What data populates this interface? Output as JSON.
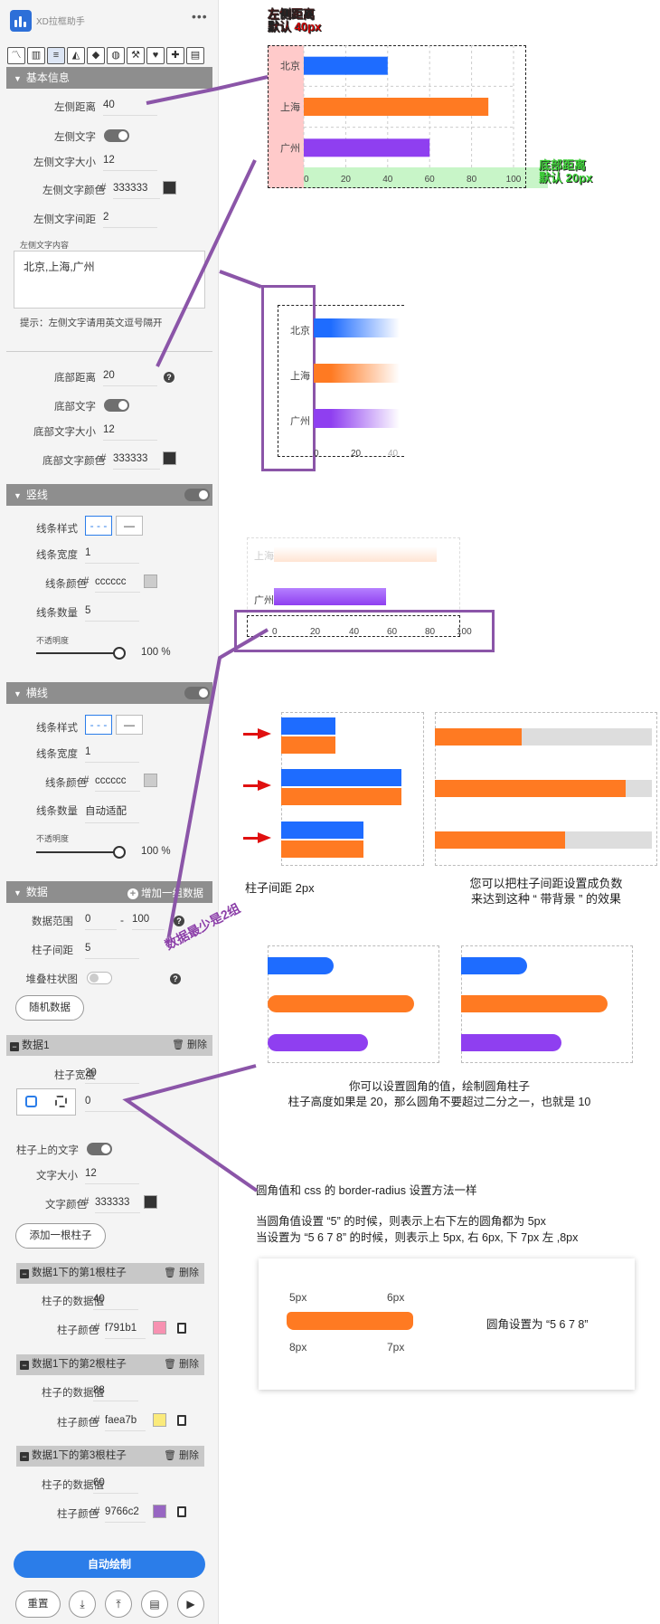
{
  "app": {
    "title": "XD拉框助手",
    "more": "•••"
  },
  "toolbar": {
    "icons": [
      "line-chart-icon",
      "bar-chart-icon",
      "horizontal-bar-icon",
      "area-chart-icon",
      "shape-icon",
      "globe-icon",
      "wrench-icon",
      "heart-icon",
      "puzzle-icon",
      "book-icon"
    ]
  },
  "basic": {
    "title": "基本信息",
    "left_distance_label": "左侧距离",
    "left_distance": "40",
    "left_text_label": "左侧文字",
    "left_font_size_label": "左侧文字大小",
    "left_font_size": "12",
    "left_color_label": "左侧文字颜色",
    "left_color_hash": "#",
    "left_color": "333333",
    "left_spacing_label": "左侧文字间距",
    "left_spacing": "2",
    "left_content_label": "左侧文字内容",
    "left_content": "北京,上海,广州",
    "tip": "提示：左侧文字请用英文逗号隔开",
    "bottom_distance_label": "底部距离",
    "bottom_distance": "20",
    "bottom_text_label": "底部文字",
    "bottom_font_size_label": "底部文字大小",
    "bottom_font_size": "12",
    "bottom_color_label": "底部文字颜色",
    "bottom_color_hash": "#",
    "bottom_color": "333333"
  },
  "vline": {
    "title": "竖线",
    "style_label": "线条样式",
    "width_label": "线条宽度",
    "width": "1",
    "color_label": "线条颜色",
    "color_hash": "#",
    "color": "cccccc",
    "count_label": "线条数量",
    "count": "5",
    "opacity_label": "不透明度",
    "opacity": "100 %"
  },
  "hline": {
    "title": "横线",
    "style_label": "线条样式",
    "width_label": "线条宽度",
    "width": "1",
    "color_label": "线条颜色",
    "color_hash": "#",
    "color": "cccccc",
    "count_label": "线条数量",
    "count": "自动适配",
    "opacity_label": "不透明度",
    "opacity": "100 %"
  },
  "data": {
    "title": "数据",
    "add_group": "增加一组数据",
    "range_label": "数据范围",
    "range_min": "0",
    "range_sep": "-",
    "range_max": "100",
    "bar_gap_label": "柱子间距",
    "bar_gap": "5",
    "stack_label": "堆叠柱状图",
    "random": "随机数据"
  },
  "data1": {
    "title": "数据1",
    "delete": "删除",
    "bar_width_label": "柱子宽度",
    "bar_width": "20",
    "radius": "0",
    "bar_text_label": "柱子上的文字",
    "font_size_label": "文字大小",
    "font_size": "12",
    "text_color_label": "文字颜色",
    "text_color_hash": "#",
    "text_color": "333333",
    "add_bar": "添加一根柱子",
    "bars": [
      {
        "title": "数据1下的第1根柱子",
        "delete": "删除",
        "value_label": "柱子的数据值",
        "value": "40",
        "color_label": "柱子颜色",
        "hash": "#",
        "color": "f791b1",
        "swatch": "#f791b1"
      },
      {
        "title": "数据1下的第2根柱子",
        "delete": "删除",
        "value_label": "柱子的数据值",
        "value": "88",
        "color_label": "柱子颜色",
        "hash": "#",
        "color": "faea7b",
        "swatch": "#faea7b"
      },
      {
        "title": "数据1下的第3根柱子",
        "delete": "删除",
        "value_label": "柱子的数据值",
        "value": "60",
        "color_label": "柱子颜色",
        "hash": "#",
        "color": "9766c2",
        "swatch": "#9766c2"
      }
    ]
  },
  "footer": {
    "auto_draw": "自动绘制",
    "reset": "重置"
  },
  "canvas": {
    "left_note_line1": "左侧距离",
    "left_note_line2": "默认 40px",
    "bottom_note_line1": "底部距离",
    "bottom_note_line2": "默认 20px",
    "cities": [
      "北京",
      "上海",
      "广州"
    ],
    "ticks": [
      "0",
      "20",
      "40",
      "60",
      "80",
      "100"
    ],
    "min_groups": "数据最少是2组",
    "gap_note": "柱子间距 2px",
    "negative_note_line1": "您可以把柱子间距设置成负数",
    "negative_note_line2": "来达到这种 “ 带背景 ” 的效果",
    "radius_note_line1": "你可以设置圆角的值，绘制圆角柱子",
    "radius_note_line2": "柱子高度如果是 20，那么圆角不要超过二分之一，也就是 10",
    "css_note": "圆角值和 css 的 border-radius 设置方法一样",
    "five_note": "当圆角值设置 “5” 的时候，则表示上右下左的圆角都为 5px",
    "multi_note": "当设置为 “5 6 7 8” 的时候，则表示上 5px, 右 6px, 下 7px 左 ,8px",
    "corner_tl": "5px",
    "corner_tr": "6px",
    "corner_bl": "8px",
    "corner_br": "7px",
    "radius_setting": "圆角设置为 “5 6 7 8”"
  },
  "chart_data": {
    "type": "bar",
    "orientation": "horizontal",
    "categories": [
      "北京",
      "上海",
      "广州"
    ],
    "values": [
      40,
      88,
      60
    ],
    "colors": [
      "#1e6cff",
      "#ff7a22",
      "#8f3ff0"
    ],
    "xlim": [
      0,
      100
    ],
    "grid": true,
    "title": "",
    "xlabel": "",
    "ylabel": ""
  }
}
